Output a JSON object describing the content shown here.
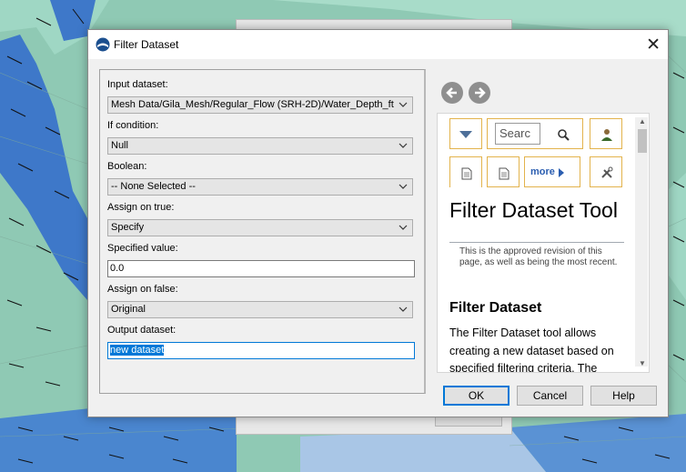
{
  "dialog": {
    "title": "Filter Dataset",
    "close_glyph": "✕"
  },
  "form": {
    "input_dataset_label": "Input dataset:",
    "input_dataset_value": "Mesh Data/Gila_Mesh/Regular_Flow (SRH-2D)/Water_Depth_ft",
    "if_condition_label": "If condition:",
    "if_condition_value": "Null",
    "boolean_label": "Boolean:",
    "boolean_value": "-- None Selected --",
    "assign_true_label": "Assign on true:",
    "assign_true_value": "Specify",
    "specified_value_label": "Specified value:",
    "specified_value": "0.0",
    "assign_false_label": "Assign on false:",
    "assign_false_value": "Original",
    "output_dataset_label": "Output dataset:",
    "output_dataset_value": "new dataset"
  },
  "help": {
    "search_placeholder": "Searc",
    "more_label": "more",
    "title": "Filter Dataset Tool",
    "revision_note": "This is the approved revision of this page, as well as being the most recent.",
    "section_heading": "Filter Dataset",
    "body": "The Filter Dataset tool allows creating a new dataset based on specified filtering criteria. The"
  },
  "buttons": {
    "ok": "OK",
    "cancel": "Cancel",
    "help": "Help"
  },
  "icons": {
    "app": "sms-globe-icon",
    "back": "arrow-left-icon",
    "forward": "arrow-right-icon",
    "dropdown": "triangle-down-icon",
    "search": "magnifier-icon",
    "user": "user-icon",
    "page": "page-icon",
    "tools": "tools-icon"
  },
  "colors": {
    "accent": "#0078d7",
    "help_border": "#e3b34c",
    "link": "#2a5db0",
    "map_water": "#3e78c9",
    "map_land": "#8fc9b4"
  }
}
